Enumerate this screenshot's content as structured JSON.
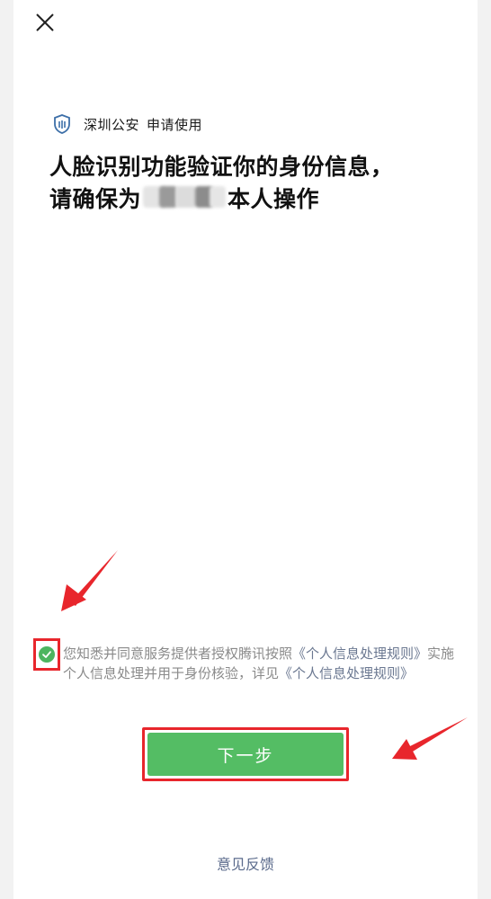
{
  "header": {
    "close_icon": "close-icon"
  },
  "app": {
    "icon": "shield-icon",
    "name": "深圳公安",
    "action": "申请使用"
  },
  "title": {
    "line1": "人脸识别功能验证你的身份信息，",
    "line2_prefix": "请确保为",
    "line2_suffix": "本人操作"
  },
  "consent": {
    "checked": true,
    "text_part1": "您知悉并同意服务提供者授权腾讯按照",
    "link1": "《个人信息处理规则》",
    "text_part2": "实施个人信息处理并用于身份核验，详见",
    "link2": "《个人信息处理规则》"
  },
  "next_button": {
    "label": "下一步"
  },
  "feedback": {
    "label": "意见反馈"
  },
  "colors": {
    "accent_green": "#54bd64",
    "highlight_red": "#e8262c",
    "link_blue": "#5b6b8c"
  }
}
